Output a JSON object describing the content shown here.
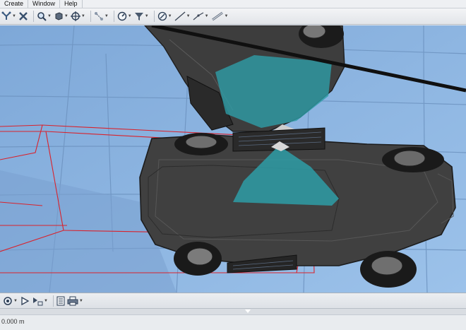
{
  "menu": {
    "items": [
      "Create",
      "Window",
      "Help"
    ]
  },
  "toolbar": {
    "icons": [
      "links-icon",
      "delete-icon",
      "zoom-icon",
      "cube-icon",
      "move-icon",
      "select-icon",
      "gauge-icon",
      "filter-icon",
      "measure-icon",
      "line-icon",
      "polyline-icon",
      "ruler-icon"
    ]
  },
  "bottom_toolbar": {
    "icons": [
      "camera-icon",
      "play-icon",
      "step-icon",
      "document-icon",
      "print-icon"
    ]
  },
  "status": {
    "distance": "0.000 m"
  },
  "colors": {
    "viewport_bg": "#87b2e0",
    "grid": "#6f95c2",
    "car_body": "#3f3f3f",
    "sensor_cone": "#2e9ea7",
    "bounding_box": "#d9222c"
  }
}
